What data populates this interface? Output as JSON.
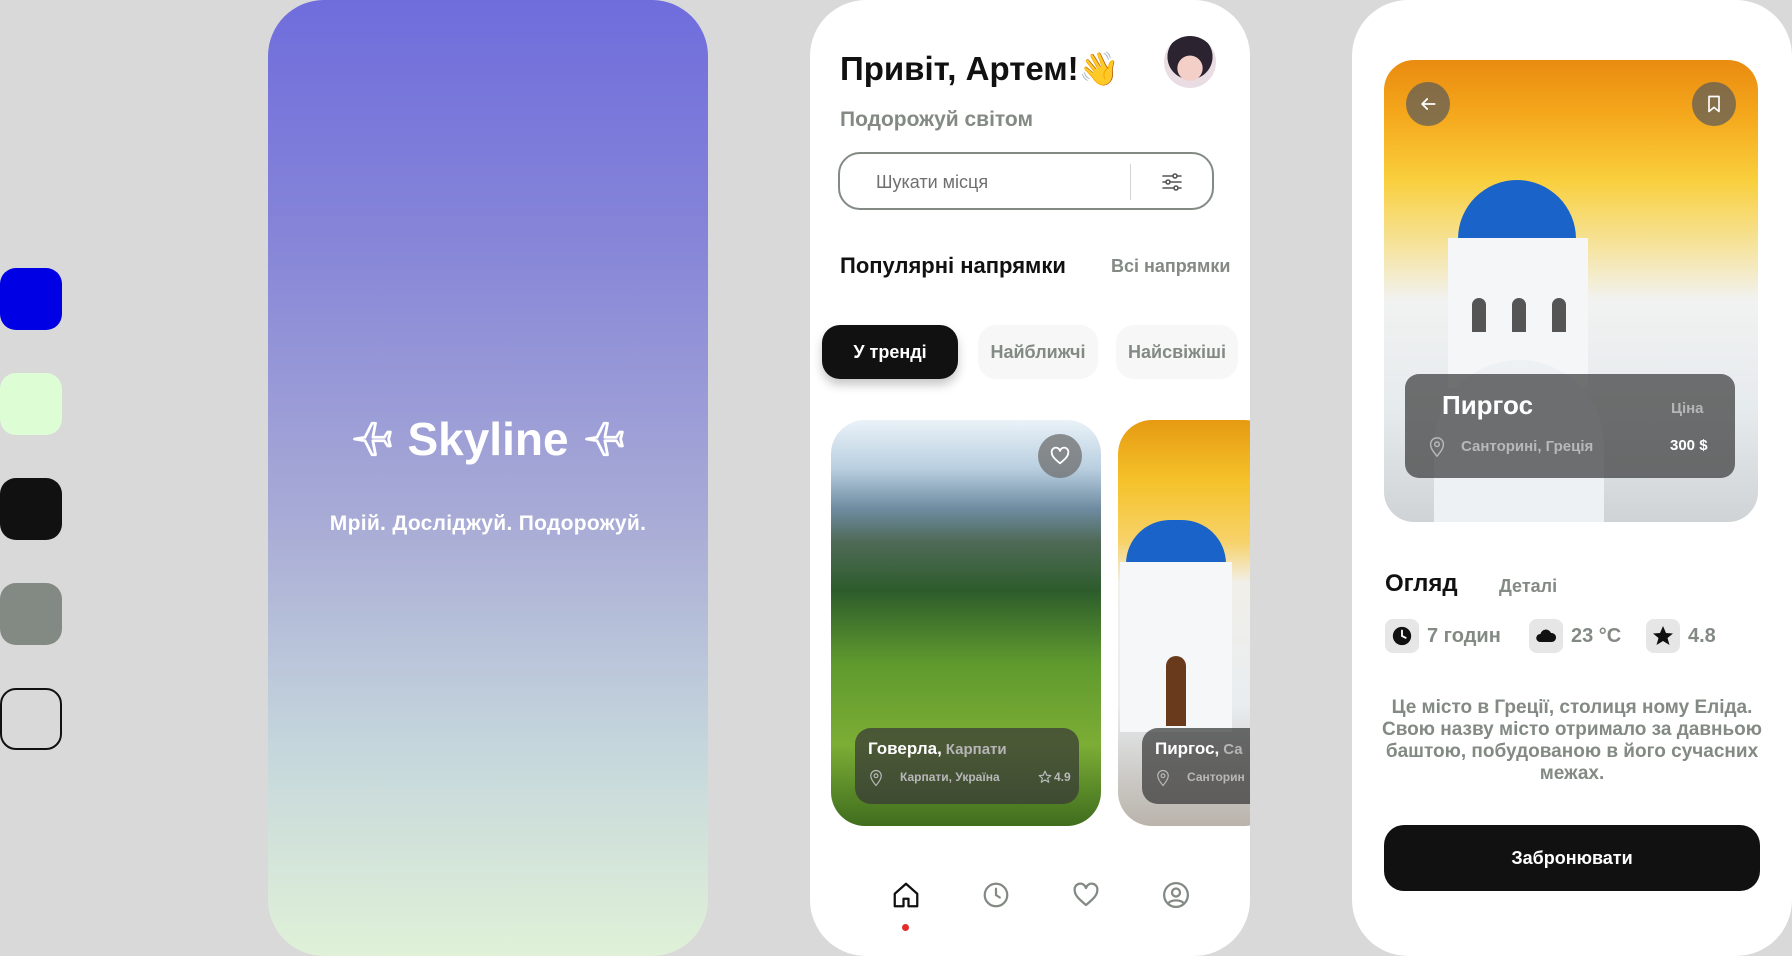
{
  "palette": {
    "colors": [
      "#0000e5",
      "#ddfdd4",
      "#111111",
      "#838a84",
      "outline"
    ]
  },
  "splash": {
    "brand": "Skyline",
    "tagline": "Мрій. Досліджуй. Подорожуй.",
    "icon": "plane-icon"
  },
  "home": {
    "greeting": "Привіт, Артем!👋",
    "subtitle": "Подорожуй світом",
    "search": {
      "placeholder": "Шукати місця",
      "filter_icon": "sliders-icon"
    },
    "section_title": "Популярні напрямки",
    "section_link": "Всі напрямки",
    "chips": [
      "У тренді",
      "Найближчі",
      "Найсвіжіші"
    ],
    "active_chip": "У тренді",
    "cards": [
      {
        "title": "Говерла,",
        "region": "Карпати",
        "location": "Карпати, Україна",
        "rating": "4.9"
      },
      {
        "title": "Пиргос,",
        "region": "Са",
        "location": "Санторин"
      }
    ],
    "nav": [
      "home-icon",
      "clock-icon",
      "heart-icon",
      "profile-icon"
    ],
    "active_nav": "home-icon"
  },
  "detail": {
    "title": "Пиргос",
    "price_label": "Ціна",
    "location": "Санторині, Греція",
    "price": "300 $",
    "tabs": [
      "Огляд",
      "Деталі"
    ],
    "stats": [
      {
        "icon": "clock-icon",
        "value": "7 годин"
      },
      {
        "icon": "cloud-icon",
        "value": "23 °C"
      },
      {
        "icon": "star-icon",
        "value": "4.8"
      }
    ],
    "description": "Це місто в Греції, столиця ному Еліда. Свою назву місто отримало за давньою баштою, побудованою в його сучасних межах.",
    "book_button": "Забронювати"
  }
}
